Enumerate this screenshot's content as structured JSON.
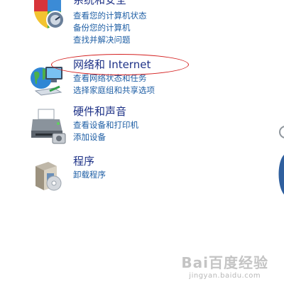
{
  "categories": [
    {
      "id": "system",
      "title": "系统和安全",
      "icon": "shield-icon",
      "links": [
        "查看您的计算机状态",
        "备份您的计算机",
        "查找并解决问题"
      ]
    },
    {
      "id": "network",
      "title": "网络和 Internet",
      "icon": "network-globe-icon",
      "links": [
        "查看网络状态和任务",
        "选择家庭组和共享选项"
      ]
    },
    {
      "id": "hardware",
      "title": "硬件和声音",
      "icon": "printer-icon",
      "links": [
        "查看设备和打印机",
        "添加设备"
      ]
    },
    {
      "id": "programs",
      "title": "程序",
      "icon": "programs-box-icon",
      "links": [
        "卸载程序"
      ]
    }
  ],
  "colors": {
    "title": "#1e3287",
    "link": "#1f5fa5",
    "annotation": "#d42020"
  },
  "watermark": {
    "brand": "Bai百度经验",
    "sub": "jingyan.baidu.com"
  }
}
